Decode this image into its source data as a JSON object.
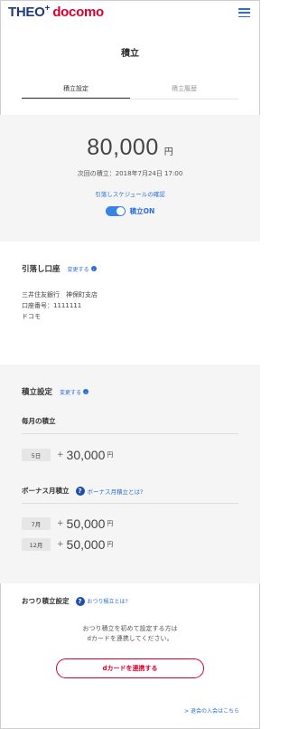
{
  "header": {
    "logo_theo": "THEO",
    "logo_plus": "+",
    "logo_docomo": "docomo",
    "menu_icon": "hamburger-icon"
  },
  "page": {
    "title": "積立"
  },
  "tabs": [
    {
      "label": "積立設定",
      "active": true
    },
    {
      "label": "積立履歴",
      "active": false
    }
  ],
  "summary": {
    "amount": "80,000",
    "unit": "円",
    "next_date": "次回の積立：2018年7月24日 17:00",
    "schedule_link": "引落しスケジュールの確認",
    "toggle_label": "積立ON",
    "toggle_on": true
  },
  "bank": {
    "title": "引落し口座",
    "edit_link": "変更する",
    "lines": [
      "三井住友銀行　神保町支店",
      "口座番号：1111111",
      "ドコモ"
    ]
  },
  "settings": {
    "title": "積立設定",
    "edit_link": "変更する",
    "monthly_label": "毎月の積立",
    "monthly": [
      {
        "day": "5日",
        "plus": "+",
        "amount": "30,000",
        "unit": "円"
      }
    ],
    "bonus_label": "ボーナス月積立",
    "bonus_link": "ボーナス月積立とは?",
    "bonus": [
      {
        "month": "7月",
        "plus": "+",
        "amount": "50,000",
        "unit": "円"
      },
      {
        "month": "12月",
        "plus": "+",
        "amount": "50,000",
        "unit": "円"
      }
    ]
  },
  "otsuri": {
    "title": "おつり積立設定",
    "link": "おつり積立とは?",
    "desc_line1": "おつり積立を初めて設定する方は",
    "desc_line2": "dカードを連携してください。",
    "button": "dカードを連携する"
  },
  "footer": {
    "inquiry_link": "> 退会の入会はこちら"
  },
  "colors": {
    "brand_navy": "#1f3b7d",
    "brand_red": "#d7002c",
    "link_blue": "#2b6fd6",
    "section_gray": "#f5f5f5"
  }
}
